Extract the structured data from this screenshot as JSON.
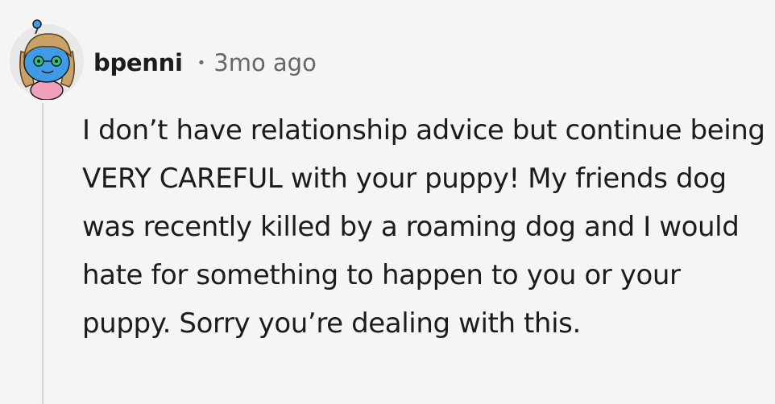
{
  "comment": {
    "author": "bpenni",
    "separator": "•",
    "timestamp": "3mo ago",
    "body": "I don’t have relationship advice but continue being VERY CAREFUL with your puppy! My friends dog was recently killed by a roaming dog and I would hate for something to happen to you or your puppy. Sorry you’re dealing with this.",
    "avatar_icon": "snoo-avatar-icon"
  },
  "colors": {
    "background": "#f5f5f5",
    "text": "#1c1c1c",
    "muted": "#666666",
    "thread_line": "#d4d4d4",
    "avatar_skin": "#3f9be6",
    "avatar_hair": "#c9a26a",
    "avatar_shirt": "#f0a0b8"
  }
}
